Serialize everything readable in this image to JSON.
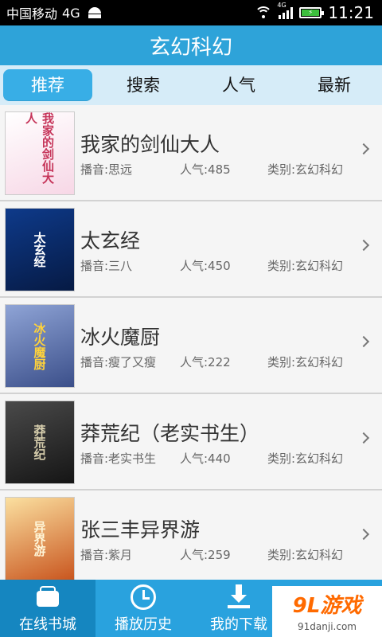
{
  "status_bar": {
    "carrier": "中国移动",
    "network": "4G",
    "signal_tag": "4G",
    "time": "11:21",
    "icons": [
      "android-icon",
      "wifi-icon",
      "signal-icon",
      "battery-icon"
    ]
  },
  "header": {
    "title": "玄幻科幻"
  },
  "tabs": [
    {
      "label": "推荐",
      "active": true
    },
    {
      "label": "搜索",
      "active": false
    },
    {
      "label": "人气",
      "active": false
    },
    {
      "label": "最新",
      "active": false
    }
  ],
  "books": [
    {
      "title": "我家的剑仙大人",
      "anchor": "播音:思远",
      "popularity": "人气:485",
      "category": "类别:玄幻科幻",
      "cover_text": "我家的剑仙大人",
      "cover_colors": [
        "#fbeff6",
        "#d14b6a"
      ]
    },
    {
      "title": "太玄经",
      "anchor": "播音:三八",
      "popularity": "人气:450",
      "category": "类别:玄幻科幻",
      "cover_text": "太玄经",
      "cover_colors": [
        "#0a2a6b",
        "#ffffff"
      ]
    },
    {
      "title": "冰火魔厨",
      "anchor": "播音:瘦了又瘦",
      "popularity": "人气:222",
      "category": "类别:玄幻科幻",
      "cover_text": "冰火魔厨",
      "cover_colors": [
        "#5a6fa8",
        "#ffd23a"
      ]
    },
    {
      "title": "莽荒纪（老实书生）",
      "anchor": "播音:老实书生",
      "popularity": "人气:440",
      "category": "类别:玄幻科幻",
      "cover_text": "莽荒纪",
      "cover_colors": [
        "#2b2b2b",
        "#cfc7a8"
      ]
    },
    {
      "title": "张三丰异界游",
      "anchor": "播音:紫月",
      "popularity": "人气:259",
      "category": "类别:玄幻科幻",
      "cover_text": "异界游",
      "cover_colors": [
        "#e89a3c",
        "#fff3c4"
      ]
    }
  ],
  "bottom_nav": [
    {
      "label": "在线书城",
      "icon": "wallet-icon",
      "active": true
    },
    {
      "label": "播放历史",
      "icon": "clock-icon",
      "active": false
    },
    {
      "label": "我的下载",
      "icon": "download-icon",
      "active": false
    }
  ],
  "watermark": {
    "logo": "9L游戏",
    "url": "91danji.com"
  },
  "colors": {
    "primary": "#2ea3d9",
    "tab_bg": "#d6ecf8",
    "tab_active": "#38aee6",
    "nav_bg": "#29a2de",
    "nav_active": "#1586c0"
  }
}
